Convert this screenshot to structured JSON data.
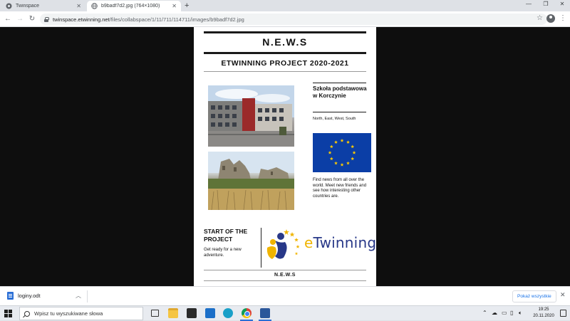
{
  "browser": {
    "tabs": [
      {
        "title": "Twinspace",
        "active": false
      },
      {
        "title": "b9badf7d2.jpg (764×1080)",
        "active": true
      }
    ],
    "new_tab_label": "+",
    "url_host": "twinspace.etwinning.net",
    "url_path": "/files/collabspace/1/11/711/114711/images/b9badf7d2.jpg",
    "icons": {
      "back": "arrow-left-icon",
      "forward": "arrow-right-icon",
      "reload": "reload-icon",
      "lock": "lock-icon",
      "star": "star-icon",
      "profile": "account-icon",
      "menu": "more-vertical-icon"
    }
  },
  "poster": {
    "title": "N.E.W.S",
    "subtitle": "ETWINNING PROJECT 2020-2021",
    "school_name": "Szkoła podstawowa w Korczynie",
    "directions": "North, East, West, South",
    "find_news": "Find news from all over the world. Meet new friends and see how interesting other countries are.",
    "start_title": "START OF THE PROJECT",
    "start_sub": "Get ready for a new adventure.",
    "logo_text_e": "e",
    "logo_text_rest": "Twinning",
    "footer": "N.E.W.S",
    "colors": {
      "eu_blue": "#0b3ea6",
      "eu_star": "#ffcc00",
      "etwinning_blue": "#283888",
      "etwinning_yellow": "#f0b400"
    }
  },
  "download_bar": {
    "file_name": "loginy.odt",
    "show_all": "Pokaż wszystkie",
    "close": "✕"
  },
  "taskbar": {
    "search_placeholder": "Wpisz tu wyszukiwane słowa",
    "time": "19:25",
    "date": "20.11.2020"
  }
}
